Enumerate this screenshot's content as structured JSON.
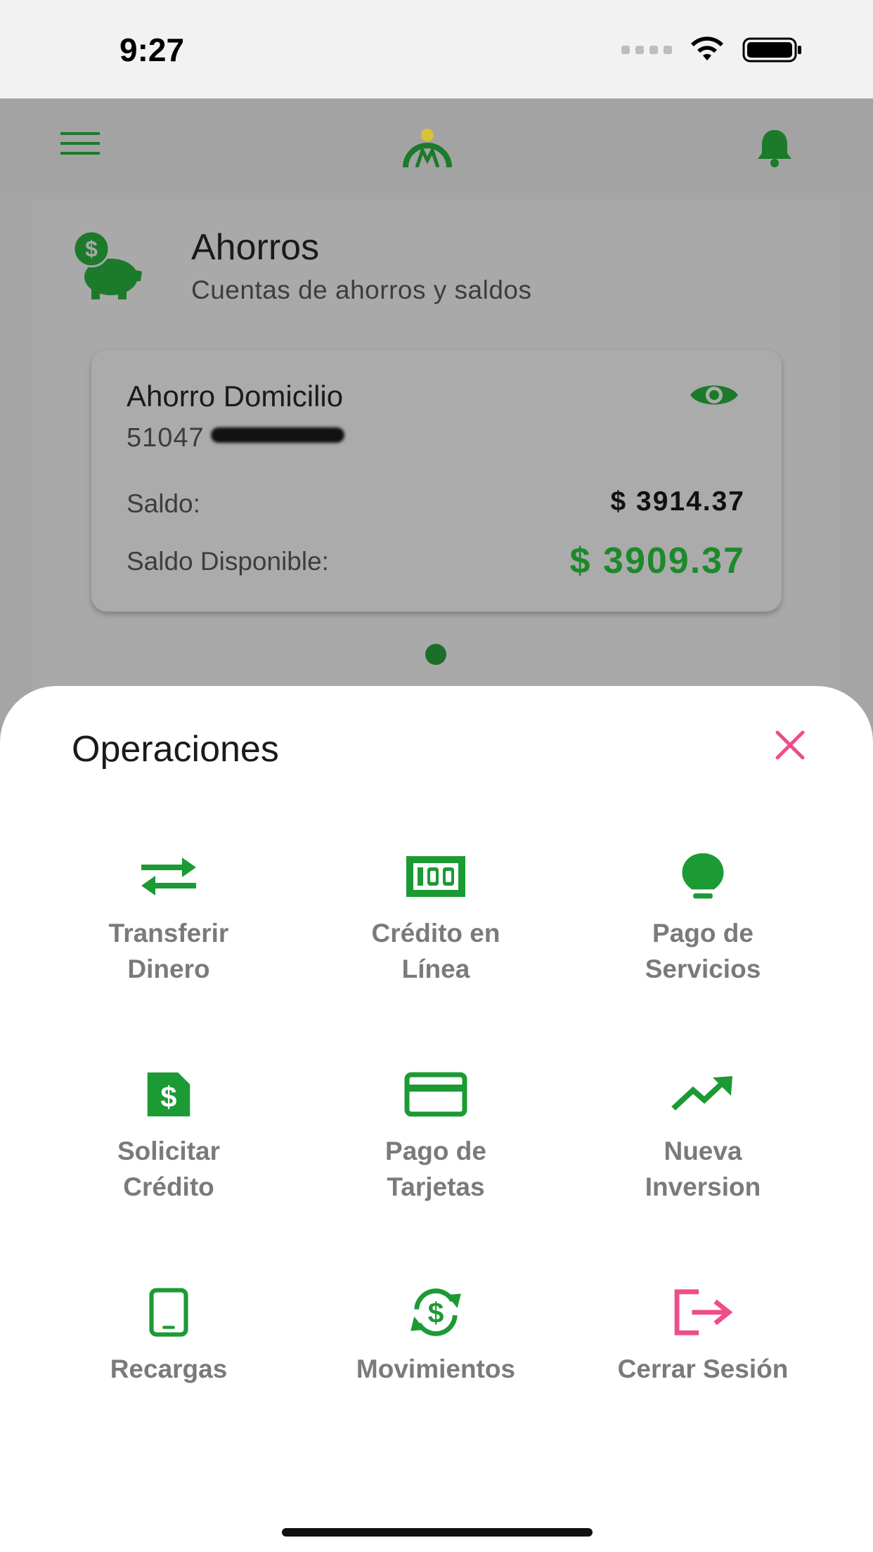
{
  "status_bar": {
    "time": "9:27"
  },
  "header": {
    "menu_icon": "menu-icon",
    "logo_icon": "logo-icon",
    "notification_icon": "bell-icon"
  },
  "section": {
    "title": "Ahorros",
    "subtitle": "Cuentas de ahorros y saldos",
    "icon": "piggy-bank-icon"
  },
  "account": {
    "name": "Ahorro Domicilio",
    "number": "51047",
    "balance_label": "Saldo:",
    "balance_value": "$ 3914.37",
    "available_label": "Saldo Disponible:",
    "available_value": "$ 3909.37"
  },
  "pager": {
    "pages": 1,
    "current": 1
  },
  "operations": {
    "title": "Operaciones",
    "items": [
      {
        "line1": "Transferir",
        "line2": "Dinero",
        "icon": "transfer-icon"
      },
      {
        "line1": "Crédito en",
        "line2": "Línea",
        "icon": "money-bill-icon"
      },
      {
        "line1": "Pago de",
        "line2": "Servicios",
        "icon": "lightbulb-icon"
      },
      {
        "line1": "Solicitar",
        "line2": "Crédito",
        "icon": "dollar-document-icon"
      },
      {
        "line1": "Pago de",
        "line2": "Tarjetas",
        "icon": "credit-card-icon"
      },
      {
        "line1": "Nueva",
        "line2": "Inversion",
        "icon": "trending-up-icon"
      },
      {
        "line1": "Recargas",
        "line2": "",
        "icon": "phone-icon"
      },
      {
        "line1": "Movimientos",
        "line2": "",
        "icon": "dollar-sync-icon"
      },
      {
        "line1": "Cerrar Sesión",
        "line2": "",
        "icon": "logout-icon"
      }
    ]
  },
  "colors": {
    "accent_green": "#1c9a34",
    "dark_green": "#1c7a2b",
    "close_pink": "#ee4d8a"
  }
}
